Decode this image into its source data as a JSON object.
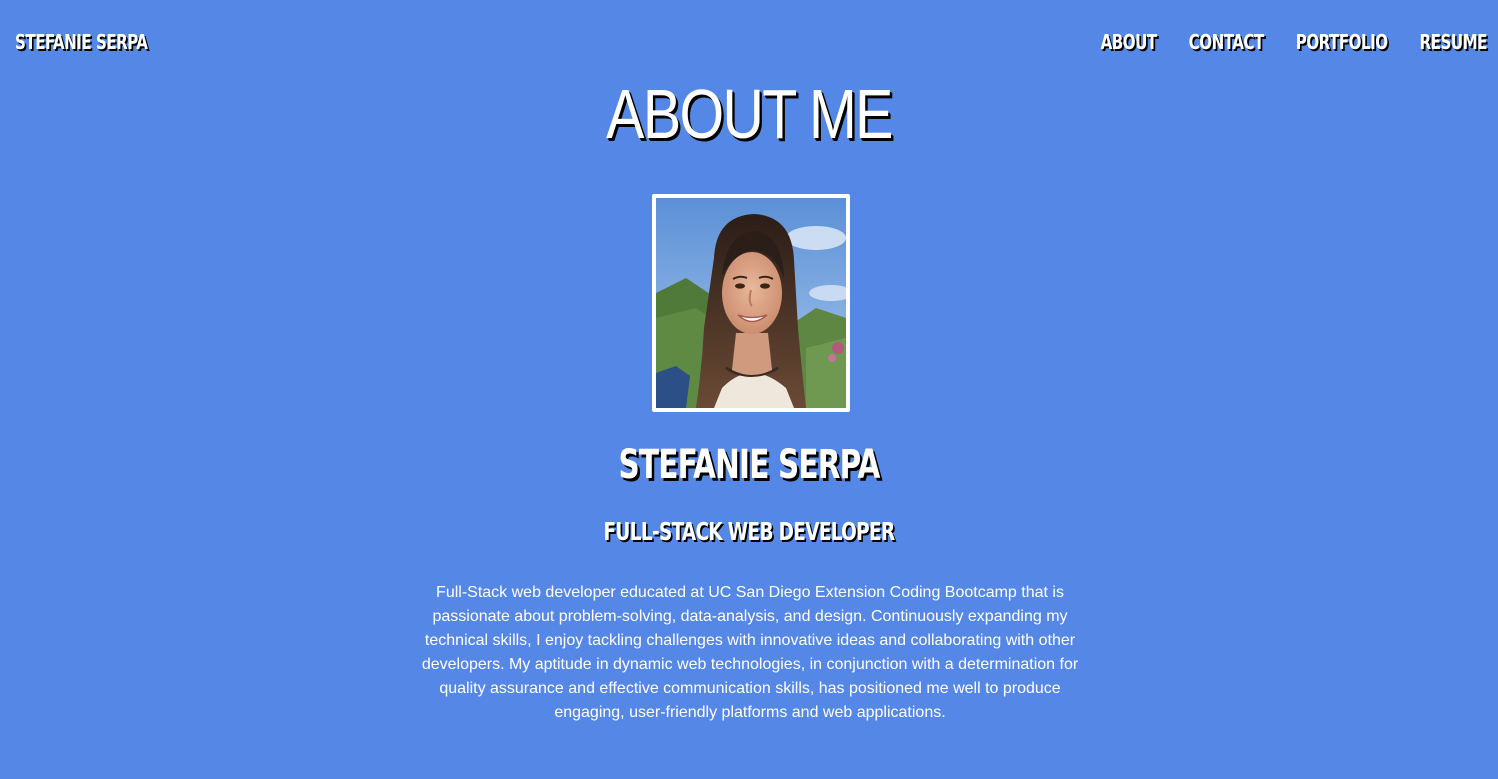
{
  "nav": {
    "brand": "STEFANIE SERPA",
    "links": [
      "ABOUT",
      "CONTACT",
      "PORTFOLIO",
      "RESUME"
    ]
  },
  "about": {
    "title": "ABOUT ME",
    "name": "STEFANIE SERPA",
    "role": "FULL-STACK WEB DEVELOPER",
    "bio": "Full-Stack web developer educated at UC San Diego Extension Coding Bootcamp that is passionate about problem-solving, data-analysis, and design. Continuously expanding my technical skills, I enjoy tackling challenges with innovative ideas and collaborating with other developers. My aptitude in dynamic web technologies, in conjunction with a determination for quality assurance and effective communication skills, has positioned me well to produce engaging, user-friendly platforms and web applications."
  },
  "colors": {
    "background": "#5588e6",
    "text": "#ffffff",
    "text_shadow": "#000000"
  }
}
